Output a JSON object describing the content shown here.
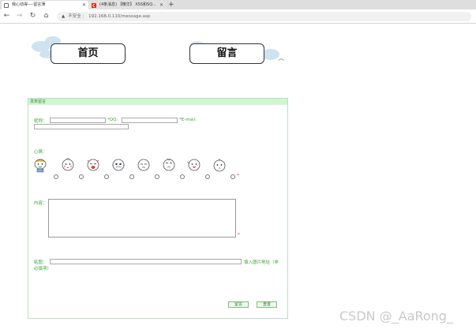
{
  "browser": {
    "tabs": [
      {
        "title": "我心动得----留言薄",
        "active": true
      },
      {
        "title": "(4条消息) 【精华】 XSS和SQ...",
        "active": false
      }
    ],
    "security_label": "不安全",
    "url": "192.168.0.110/message.asp"
  },
  "nav": {
    "home_label": "首页",
    "message_label": "留言"
  },
  "form": {
    "header": "发表留言",
    "name_label": "昵称：",
    "qq_label": "*QQ:",
    "email_label": "*E-mail:",
    "mood_label": "心情：",
    "content_label": "内容：",
    "image_label": "贴图：",
    "image_hint_line1": "填入图片地址（非",
    "image_hint_line2": "必填项）",
    "required_mark": "*",
    "submit_label": "留言",
    "reset_label": "重置",
    "mood_faces": [
      "face-1",
      "face-2",
      "face-3",
      "face-4",
      "face-5",
      "face-6",
      "face-7",
      "face-8"
    ]
  },
  "watermark": "CSDN @_AaRong_",
  "colors": {
    "label_green": "#3aa33a",
    "header_bg": "#cff6cf",
    "required_red": "#cc2222",
    "panel_border": "#b8e0c4"
  }
}
